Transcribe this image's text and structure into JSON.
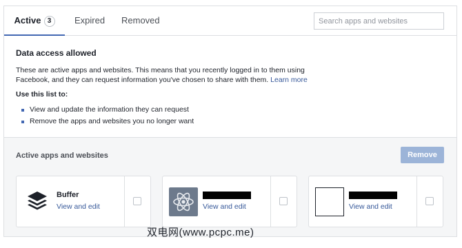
{
  "tabs": [
    {
      "label": "Active",
      "badge": "3"
    },
    {
      "label": "Expired"
    },
    {
      "label": "Removed"
    }
  ],
  "search": {
    "placeholder": "Search apps and websites"
  },
  "info": {
    "title": "Data access allowed",
    "description": "These are active apps and websites. This means that you recently logged in to them using Facebook, and they can request information you've chosen to share with them.",
    "link": "Learn more",
    "use_title": "Use this list to:",
    "bullets": [
      "View and update the information they can request",
      "Remove the apps and websites you no longer want"
    ]
  },
  "apps": {
    "title": "Active apps and websites",
    "remove_label": "Remove",
    "items": [
      {
        "name": "Buffer",
        "action": "View and edit",
        "icon": "buffer-stack-icon"
      },
      {
        "name": "",
        "action": "View and edit",
        "icon": "atom-icon"
      },
      {
        "name": "",
        "action": "View and edit",
        "icon": "blank-logo"
      }
    ]
  },
  "watermark": "双电网(www.pcpc.me)",
  "colors": {
    "accent": "#4267b2",
    "link": "#365899",
    "remove_disabled": "#9cb4d8"
  }
}
